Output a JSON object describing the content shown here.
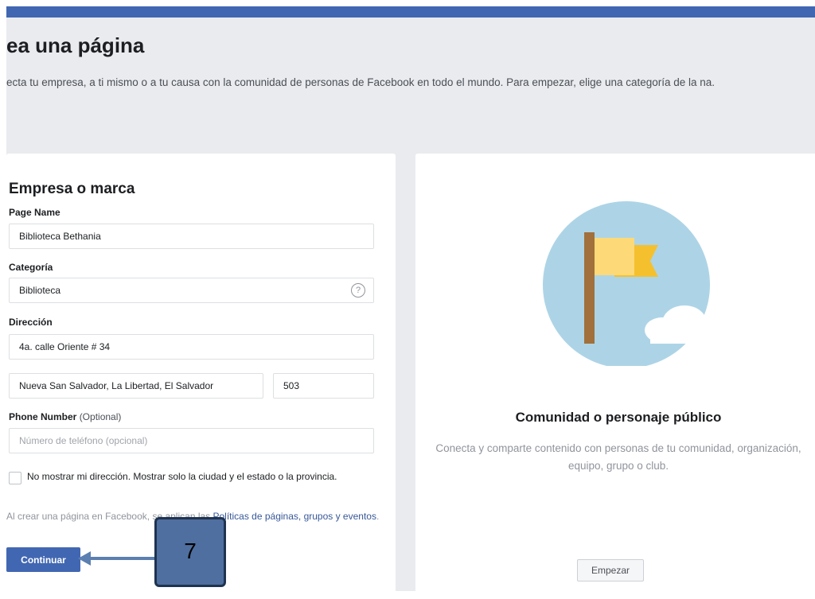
{
  "header": {
    "title": "ea una página",
    "description": "ecta tu empresa, a ti mismo o a tu causa con la comunidad de personas de Facebook en todo el mundo. Para empezar, elige una categoría de la na."
  },
  "business_card": {
    "title": "Empresa o marca",
    "page_name_label": "Page Name",
    "page_name_value": "Biblioteca Bethania",
    "category_label": "Categoría",
    "category_value": "Biblioteca",
    "help_icon": "?",
    "address_label": "Dirección",
    "address_value": "4a. calle Oriente # 34",
    "city_value": "Nueva San Salvador, La Libertad, El Salvador",
    "zip_value": "503",
    "phone_label": "Phone Number",
    "phone_optional": "(Optional)",
    "phone_placeholder": "Número de teléfono (opcional)",
    "hide_address_label": "No mostrar mi dirección. Mostrar solo la ciudad y el estado o la provincia.",
    "policy_prefix": "Al crear una página en Facebook, se aplican las ",
    "policy_link": "Políticas de páginas, grupos y eventos",
    "policy_suffix": ".",
    "continue_label": "Continuar"
  },
  "community_card": {
    "title": "Comunidad o personaje público",
    "description": "Conecta y comparte contenido con personas de tu comunidad, organización, equipo, grupo o club.",
    "start_label": "Empezar"
  },
  "callout": {
    "number": "7"
  },
  "colors": {
    "brand_blue": "#4267b2",
    "page_bg": "#e9ebee",
    "callout_fill": "#4f6fa0",
    "arrow": "#5b7fb0"
  },
  "icons": [
    "help-icon",
    "flag-illustration-icon",
    "cloud-icon",
    "arrow-icon"
  ]
}
